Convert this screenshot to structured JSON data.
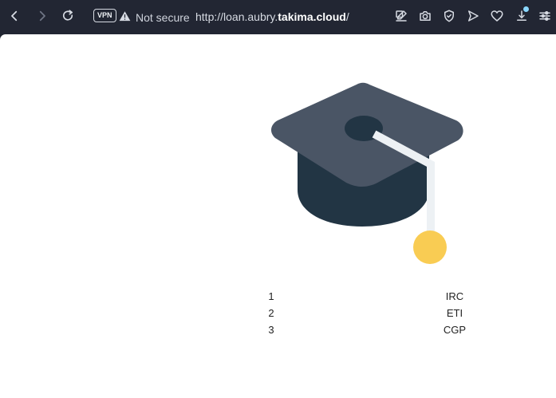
{
  "browser": {
    "vpn_label": "VPN",
    "security_status": "Not secure",
    "url_prefix": "http://loan.aubry.",
    "url_domain": "takima.cloud",
    "url_suffix": "/"
  },
  "icons": {
    "back": "chevron-left-icon",
    "forward": "chevron-right-icon",
    "reload": "reload-icon",
    "warning": "warning-icon",
    "edit": "edit-icon",
    "camera": "camera-icon",
    "shield": "shield-icon",
    "send": "send-icon",
    "heart": "heart-icon",
    "download": "download-icon",
    "settings": "settings-icon"
  },
  "page": {
    "rows": [
      {
        "number": "1",
        "code": "IRC"
      },
      {
        "number": "2",
        "code": "ETI"
      },
      {
        "number": "3",
        "code": "CGP"
      }
    ]
  },
  "colors": {
    "browser_bg": "#222633",
    "page_bg": "#ffffff",
    "cap_top": "#4a5565",
    "cap_base": "#223544",
    "tassel_cord": "#edf1f4",
    "tassel_ball": "#f9cc53"
  }
}
